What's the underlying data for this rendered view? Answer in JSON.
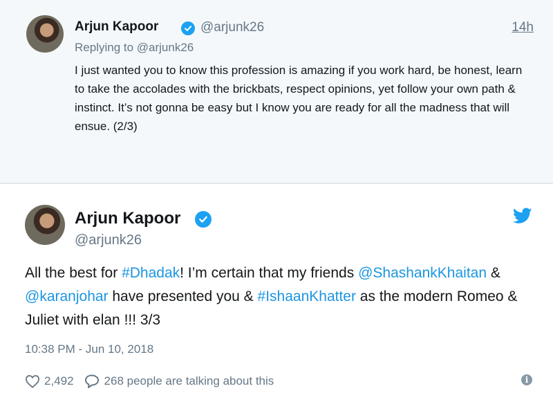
{
  "reply_tweet": {
    "author_name": "Arjun Kapoor",
    "author_handle": "@arjunk26",
    "time": "14h",
    "replying_to": "Replying to @arjunk26",
    "text": "I just wanted you to know this profession is amazing if you work hard, be honest, learn to take the accolades with the brickbats, respect opinions, yet follow your own path & instinct. It’s not gonna be easy but I know you are ready for all the madness that will ensue. (2/3)"
  },
  "main_tweet": {
    "author_name": "Arjun Kapoor",
    "author_handle": "@arjunk26",
    "text_parts": [
      {
        "text": "All the best for ",
        "type": "plain"
      },
      {
        "text": "#Dhadak",
        "type": "link"
      },
      {
        "text": "! I’m certain that my friends ",
        "type": "plain"
      },
      {
        "text": "@ShashankKhaitan",
        "type": "link"
      },
      {
        "text": " & ",
        "type": "plain"
      },
      {
        "text": "@karanjohar",
        "type": "link"
      },
      {
        "text": " have presented you & ",
        "type": "plain"
      },
      {
        "text": "#IshaanKhatter",
        "type": "link"
      },
      {
        "text": " as the modern Romeo & Juliet with elan !!! 3/3",
        "type": "plain"
      }
    ],
    "timestamp": "10:38 PM - Jun 10, 2018",
    "likes": "2,492",
    "comments_label": "268 people are talking about this"
  },
  "icons": {
    "verified": "verified-badge-icon",
    "bird": "twitter-bird-icon",
    "heart": "heart-icon",
    "comment": "comment-bubble-icon",
    "info": "info-icon"
  },
  "colors": {
    "link": "#1b95e0",
    "verified": "#1da1f2",
    "muted": "#657786",
    "reply_bg": "#f5f8fa"
  }
}
